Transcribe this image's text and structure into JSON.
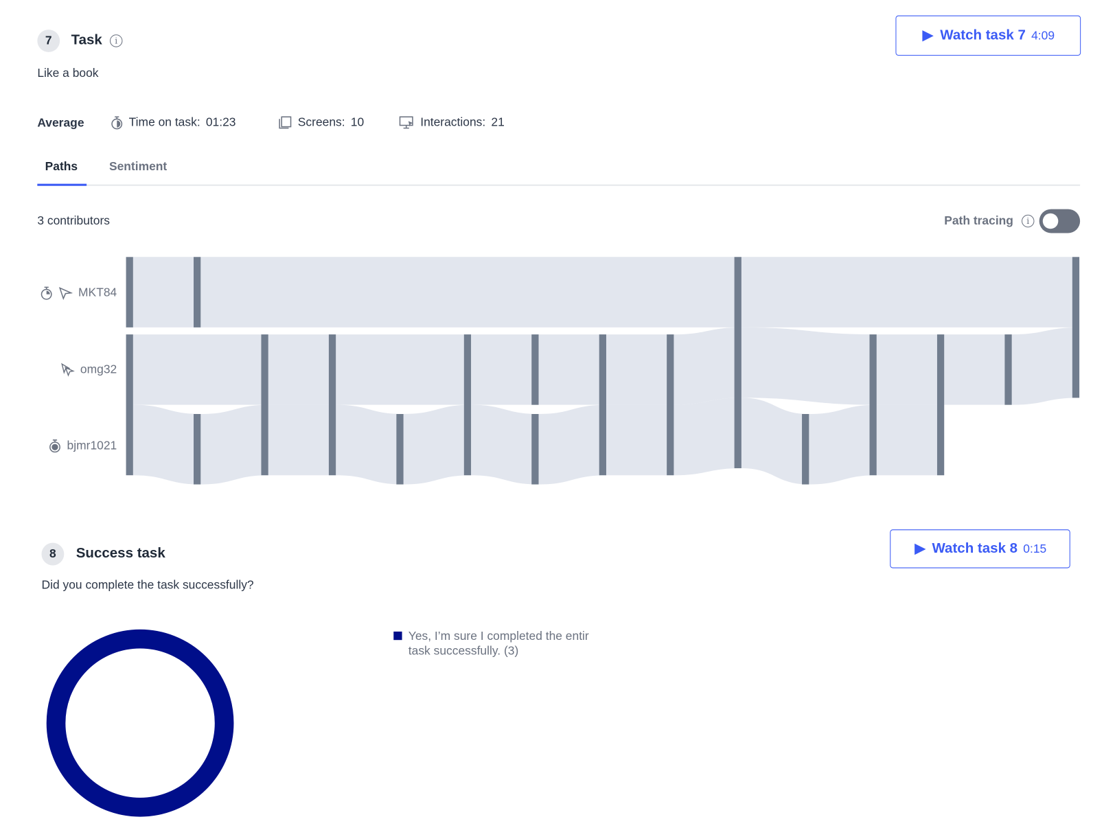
{
  "task7": {
    "number": "7",
    "title": "Task",
    "description": "Like a book",
    "watch_label": "Watch task 7",
    "watch_duration": "4:09",
    "average_label": "Average",
    "time_on_task_label": "Time on task:",
    "time_on_task_value": "01:23",
    "screens_label": "Screens:",
    "screens_value": "10",
    "interactions_label": "Interactions:",
    "interactions_value": "21",
    "tabs": [
      {
        "label": "Paths",
        "active": true
      },
      {
        "label": "Sentiment",
        "active": false
      }
    ],
    "contributors": "3 contributors",
    "path_tracing_label": "Path tracing",
    "path_tracing_on": false,
    "users": [
      {
        "name": "MKT84",
        "icons": [
          "stopwatch-icon",
          "cursor-icon"
        ]
      },
      {
        "name": "omg32",
        "icons": [
          "multi-click-icon"
        ]
      },
      {
        "name": "bjmr1021",
        "icons": [
          "stopwatch-icon"
        ]
      }
    ],
    "paths_chart": {
      "columns": [
        [
          [
            "MKT84"
          ],
          [
            "omg32",
            "bjmr1021"
          ]
        ],
        [
          [
            "MKT84"
          ],
          [
            "bjmr1021"
          ]
        ],
        [
          [
            "omg32",
            "bjmr1021"
          ]
        ],
        [
          [
            "omg32",
            "bjmr1021"
          ]
        ],
        [
          [
            "bjmr1021"
          ]
        ],
        [
          [
            "omg32",
            "bjmr1021"
          ]
        ],
        [
          [
            "omg32"
          ],
          [
            "bjmr1021"
          ]
        ],
        [
          [
            "omg32",
            "bjmr1021"
          ]
        ],
        [
          [
            "omg32",
            "bjmr1021"
          ]
        ],
        [
          [
            "MKT84",
            "omg32",
            "bjmr1021"
          ]
        ],
        [
          [
            "bjmr1021"
          ]
        ],
        [
          [
            "omg32",
            "bjmr1021"
          ]
        ],
        [
          [
            "omg32",
            "bjmr1021"
          ]
        ],
        [
          [
            "omg32"
          ]
        ],
        [
          [
            "MKT84",
            "omg32"
          ]
        ]
      ],
      "node_color": "#717d8e",
      "link_color": "#e2e6ee"
    }
  },
  "task8": {
    "number": "8",
    "title": "Success task",
    "question": "Did you complete the task successfully?",
    "watch_label": "Watch task 8",
    "watch_duration": "0:15",
    "chart_data": {
      "type": "pie",
      "donut": true,
      "slices": [
        {
          "label": "Yes, I’m sure I completed the entir task successfully. (3)",
          "value": 3,
          "color": "#000e8a"
        }
      ],
      "legend_line1": "Yes, I’m sure I completed the entir",
      "legend_line2": "task successfully. (3)",
      "legend": "right"
    }
  },
  "colors": {
    "accent": "#3b5bf5",
    "donut": "#000e8a"
  }
}
